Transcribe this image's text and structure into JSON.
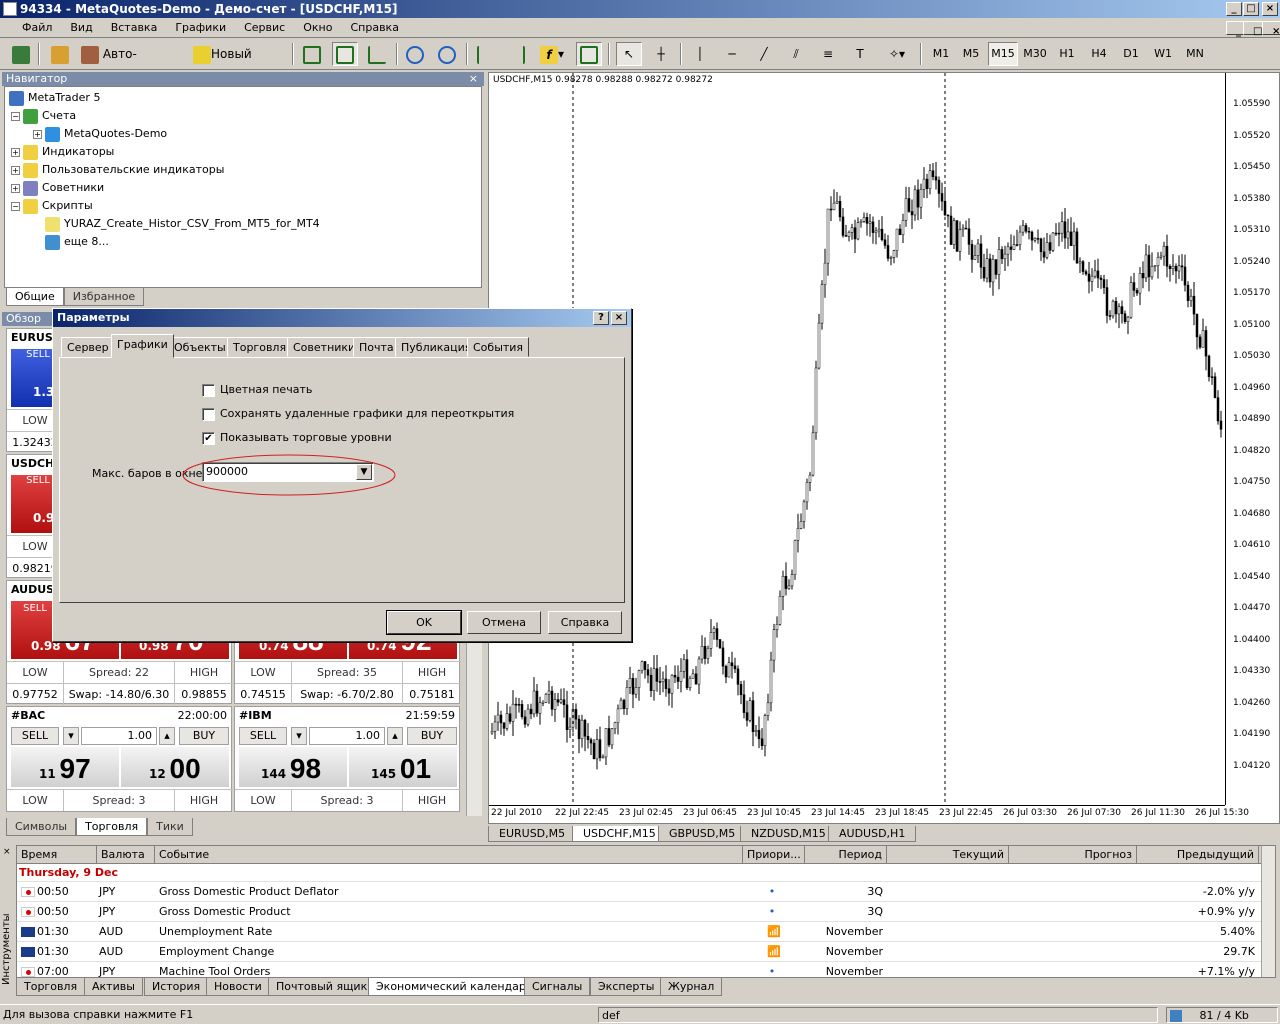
{
  "window": {
    "title": "94334 - MetaQuotes-Demo - Демо-счет - [USDCHF,M15]"
  },
  "menu": [
    "Файл",
    "Вид",
    "Вставка",
    "Графики",
    "Сервис",
    "Окно",
    "Справка"
  ],
  "toolbar": {
    "autotrading": "Авто-торговля",
    "new_order": "Новый ордер",
    "timeframes": [
      "M1",
      "M5",
      "M15",
      "M30",
      "H1",
      "H4",
      "D1",
      "W1",
      "MN"
    ],
    "active_tf": "M15"
  },
  "navigator": {
    "title": "Навигатор",
    "items": [
      {
        "label": "MetaTrader 5"
      },
      {
        "label": "Счета"
      },
      {
        "label": "MetaQuotes-Demo"
      },
      {
        "label": "Индикаторы"
      },
      {
        "label": "Пользовательские индикаторы"
      },
      {
        "label": "Советники"
      },
      {
        "label": "Скрипты"
      },
      {
        "label": "YURAZ_Create_Histor_CSV_From_MT5_for_MT4"
      },
      {
        "label": "еще 8..."
      }
    ],
    "tabs": [
      "Общие",
      "Избранное"
    ]
  },
  "market_watch": {
    "title": "Обзор ры",
    "cards": [
      {
        "sym": "EURUSD",
        "sell": "SELL",
        "big": "1.33",
        "low": "LOW",
        "lowv": "1.32432"
      },
      {
        "sym": "USDCHF",
        "sell": "SELL",
        "big": "0.98",
        "low": "LOW",
        "lowv": "0.98219"
      },
      {
        "sym": "AUDUSD",
        "sell": "SELL",
        "sellp_s": "0.98",
        "sellp_b": "67",
        "buyp_s": "0.98",
        "buyp_b": "70",
        "low": "LOW",
        "spread": "Spread: 22",
        "high": "HIGH",
        "lowv": "0.97752",
        "swap": "Swap: -14.80/6.30",
        "highv": "0.98855"
      },
      {
        "sym": "",
        "sellp_s": "0.74",
        "sellp_b": "88",
        "buyp_s": "0.74",
        "buyp_b": "92",
        "low": "LOW",
        "spread": "Spread: 35",
        "high": "HIGH",
        "lowv": "0.74515",
        "swap": "Swap: -6.70/2.80",
        "highv": "0.75181"
      },
      {
        "sym": "#BAC",
        "time": "22:00:00",
        "sell": "SELL",
        "buy": "BUY",
        "vol": "1.00",
        "sellp_s": "11",
        "sellp_b": "97",
        "buyp_s": "12",
        "buyp_b": "00",
        "low": "LOW",
        "spread": "Spread: 3",
        "high": "HIGH"
      },
      {
        "sym": "#IBM",
        "time": "21:59:59",
        "sell": "SELL",
        "buy": "BUY",
        "vol": "1.00",
        "sellp_s": "144",
        "sellp_b": "98",
        "buyp_s": "145",
        "buyp_b": "01",
        "low": "LOW",
        "spread": "Spread: 3",
        "high": "HIGH"
      }
    ],
    "tabs": [
      "Символы",
      "Торговля",
      "Тики"
    ]
  },
  "chart": {
    "header": "USDCHF,M15  0.98278 0.98288 0.98272 0.98272",
    "prices": [
      "1.05590",
      "1.05520",
      "1.05450",
      "1.05380",
      "1.05310",
      "1.05240",
      "1.05170",
      "1.05100",
      "1.05030",
      "1.04960",
      "1.04890",
      "1.04820",
      "1.04750",
      "1.04680",
      "1.04610",
      "1.04540",
      "1.04470",
      "1.04400",
      "1.04330",
      "1.04260",
      "1.04190",
      "1.04120"
    ],
    "times": [
      "22 Jul 2010",
      "22 Jul 22:45",
      "23 Jul 02:45",
      "23 Jul 06:45",
      "23 Jul 10:45",
      "23 Jul 14:45",
      "23 Jul 18:45",
      "23 Jul 22:45",
      "26 Jul 03:30",
      "26 Jul 07:30",
      "26 Jul 11:30",
      "26 Jul 15:30"
    ],
    "tabs": [
      "EURUSD,M5",
      "USDCHF,M15",
      "GBPUSD,M5",
      "NZDUSD,M15",
      "AUDUSD,H1"
    ],
    "active_tab": "USDCHF,M15"
  },
  "dialog": {
    "title": "Параметры",
    "help": "?",
    "tabs": [
      "Сервер",
      "Графики",
      "Объекты",
      "Торговля",
      "Советники",
      "Почта",
      "Публикация",
      "События"
    ],
    "active_tab": "Графики",
    "options": [
      {
        "label": "Цветная печать",
        "checked": false
      },
      {
        "label": "Сохранять удаленные графики для переоткрытия",
        "checked": false
      },
      {
        "label": "Показывать торговые уровни",
        "checked": true
      }
    ],
    "max_bars_label": "Макс. баров в окне:",
    "max_bars_value": "900000",
    "ok": "OK",
    "cancel": "Отмена",
    "help_btn": "Справка"
  },
  "calendar": {
    "columns": [
      "Время",
      "Валюта",
      "Событие",
      "Приори...",
      "Период",
      "Текущий",
      "Прогноз",
      "Предыдущий"
    ],
    "date_row": "Thursday, 9 Dec",
    "rows": [
      {
        "time": "00:50",
        "cur": "JPY",
        "event": "Gross Domestic Product Deflator",
        "period": "3Q",
        "prev": "-2.0% y/y",
        "flag": "jp"
      },
      {
        "time": "00:50",
        "cur": "JPY",
        "event": "Gross Domestic Product",
        "period": "3Q",
        "prev": "+0.9% y/y",
        "flag": "jp"
      },
      {
        "time": "01:30",
        "cur": "AUD",
        "event": "Unemployment Rate",
        "period": "November",
        "prev": "5.40%",
        "flag": "au"
      },
      {
        "time": "01:30",
        "cur": "AUD",
        "event": "Employment Change",
        "period": "November",
        "prev": "29.7K",
        "flag": "au"
      },
      {
        "time": "07:00",
        "cur": "JPY",
        "event": "Machine Tool Orders",
        "period": "November",
        "prev": "+7.1% y/y",
        "flag": "jp"
      }
    ],
    "side_label": "Инструменты"
  },
  "bottom_tabs": [
    "Торговля",
    "Активы",
    "История",
    "Новости",
    "Почтовый ящик",
    "Экономический календарь",
    "Сигналы",
    "Эксперты",
    "Журнал"
  ],
  "bottom_active": "Экономический календарь",
  "status": {
    "help": "Для вызова справки нажмите F1",
    "profile": "def",
    "traffic": "81 / 4 Kb"
  }
}
